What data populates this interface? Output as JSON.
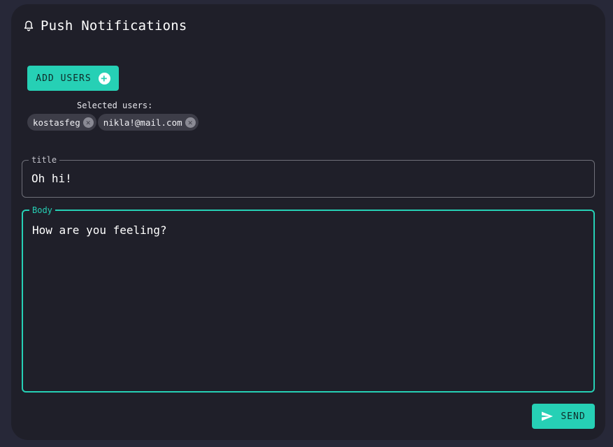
{
  "header": {
    "title": "Push Notifications",
    "icon": "bell-icon"
  },
  "add_users": {
    "label": "ADD USERS",
    "icon": "add-circle-icon"
  },
  "selected_users": {
    "label": "Selected users:",
    "users": [
      "kostasfeg",
      "nikla!@mail.com"
    ]
  },
  "form": {
    "title_field": {
      "label": "title",
      "value": "Oh hi!"
    },
    "body_field": {
      "label": "Body",
      "value": "How are you feeling?"
    }
  },
  "send": {
    "label": "SEND",
    "icon": "send-icon"
  },
  "colors": {
    "accent": "#26d0b5",
    "page_bg": "#272838",
    "card_bg": "#1f1f29",
    "chip_bg": "#3d3d48"
  }
}
